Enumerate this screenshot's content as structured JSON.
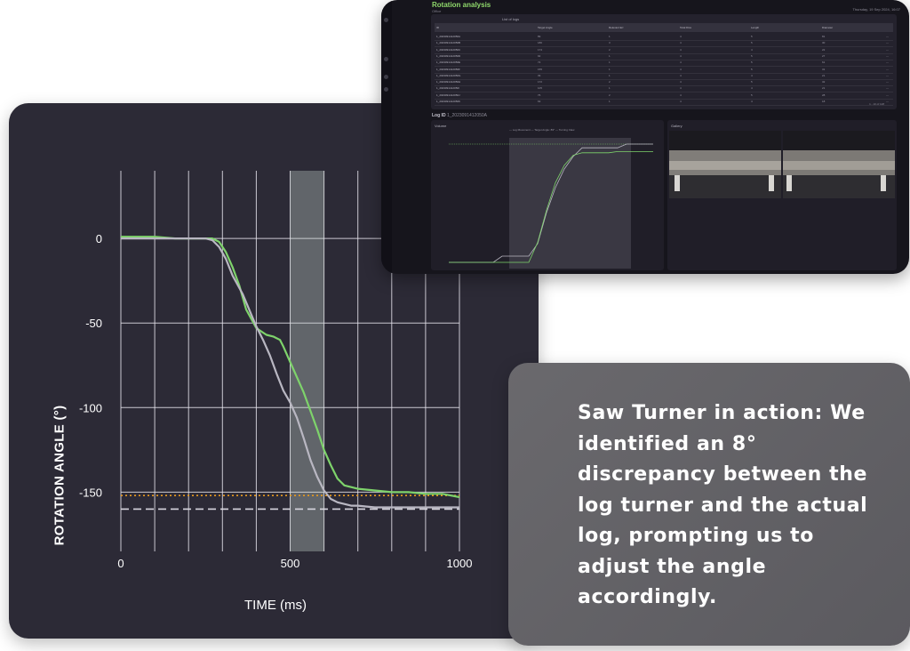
{
  "chart_data": {
    "type": "line",
    "title": "",
    "xlabel": "TIME (ms)",
    "ylabel": "ROTATION ANGLE (°)",
    "xlim": [
      0,
      1000
    ],
    "ylim": [
      -185,
      40
    ],
    "x_ticks": [
      0,
      500,
      1000
    ],
    "y_ticks": [
      0,
      -50,
      -100,
      -150
    ],
    "grid": true,
    "highlight_band": [
      500,
      600
    ],
    "series": [
      {
        "color": "#7ed36b",
        "x": [
          0,
          100,
          160,
          230,
          270,
          290,
          310,
          330,
          350,
          370,
          400,
          430,
          450,
          470,
          480,
          500,
          520,
          540,
          560,
          580,
          600,
          620,
          640,
          660,
          700,
          750,
          800,
          850,
          900,
          950,
          975,
          1000
        ],
        "y": [
          1,
          1,
          0,
          0,
          0,
          -2,
          -8,
          -17,
          -28,
          -42,
          -53,
          -57,
          -58,
          -60,
          -64,
          -73,
          -82,
          -91,
          -102,
          -113,
          -125,
          -134,
          -142,
          -146,
          -148,
          -149,
          -150,
          -150,
          -151,
          -151,
          -152,
          -153
        ]
      },
      {
        "color": "#b9b7c2",
        "x": [
          0,
          100,
          200,
          250,
          270,
          290,
          310,
          330,
          360,
          400,
          420,
          440,
          460,
          480,
          500,
          520,
          540,
          560,
          580,
          600,
          620,
          640,
          660,
          680,
          700,
          750,
          800,
          850,
          900,
          950,
          1000
        ],
        "y": [
          0,
          0,
          0,
          0,
          -1,
          -5,
          -12,
          -22,
          -33,
          -52,
          -60,
          -69,
          -80,
          -90,
          -97,
          -106,
          -118,
          -131,
          -141,
          -149,
          -154,
          -156,
          -157,
          -158,
          -158,
          -159,
          -159,
          -159,
          -159,
          -159,
          -159
        ]
      }
    ],
    "reference_lines": [
      {
        "y": -152,
        "style": "dotted",
        "color": "#e89a1f"
      },
      {
        "y": -160,
        "style": "dashed",
        "color": "#d8d6df"
      }
    ]
  },
  "app_screenshot": {
    "title": "Rotation analysis",
    "subtitle": "Office",
    "date": "Thursday, 19 Sep 2024, 16:07",
    "table_heading": "List of logs",
    "columns": [
      "ID",
      "Target Angle",
      "Relevant Err",
      "Total Diss",
      "Length",
      "Diameter"
    ],
    "rows": [
      [
        "1_2023091412050A",
        "89",
        "1",
        "4",
        "5",
        "81"
      ],
      [
        "1_2023091412050B",
        "180",
        "3",
        "4",
        "5",
        "30"
      ],
      [
        "1_2023091412050C",
        "174",
        "2",
        "4",
        "4",
        "22"
      ],
      [
        "1_2023091412050D",
        "92",
        "1",
        "4",
        "5",
        "27"
      ],
      [
        "1_2023091412050E",
        "72",
        "1",
        "4",
        "5",
        "61"
      ],
      [
        "1_2023091412050F",
        "155",
        "1",
        "4",
        "5",
        "31"
      ],
      [
        "1_2023091412050G",
        "39",
        "1",
        "4",
        "4",
        "21"
      ],
      [
        "1_2023091412050H",
        "172",
        "2",
        "4",
        "5",
        "32"
      ],
      [
        "1_2023091412050I",
        "105",
        "1",
        "4",
        "4",
        "21"
      ],
      [
        "1_2023091412050J",
        "76",
        "2",
        "4",
        "5",
        "28"
      ],
      [
        "1_2023091412050K",
        "63",
        "1",
        "4",
        "4",
        "18"
      ]
    ],
    "pager": "1 - 10 of 128",
    "log_id_label": "Log ID",
    "log_id_value": "1_2023091412050A",
    "volume_label": "Volume",
    "gallery_label": "Gallery",
    "legend": [
      "Log Movement",
      "Target Angle: 89°",
      "Turning Claw"
    ],
    "mini_chart": {
      "series": [
        {
          "color": "#b9b7c2",
          "y": [
            0,
            0,
            0,
            0,
            0,
            0,
            5,
            5,
            5,
            5,
            15,
            40,
            60,
            75,
            85,
            92,
            92,
            92,
            92,
            92,
            95,
            95,
            95,
            95
          ]
        },
        {
          "color": "#7ed36b",
          "y": [
            0,
            0,
            0,
            0,
            0,
            0,
            0,
            0,
            0,
            0,
            16,
            42,
            64,
            78,
            86,
            88,
            88,
            88,
            88,
            89,
            89,
            89,
            89,
            89
          ]
        }
      ]
    }
  },
  "caption": {
    "text": "Saw Turner in action: We identified an 8° discrepancy between the log turner and the actual log, prompting us to adjust the angle accordingly."
  }
}
